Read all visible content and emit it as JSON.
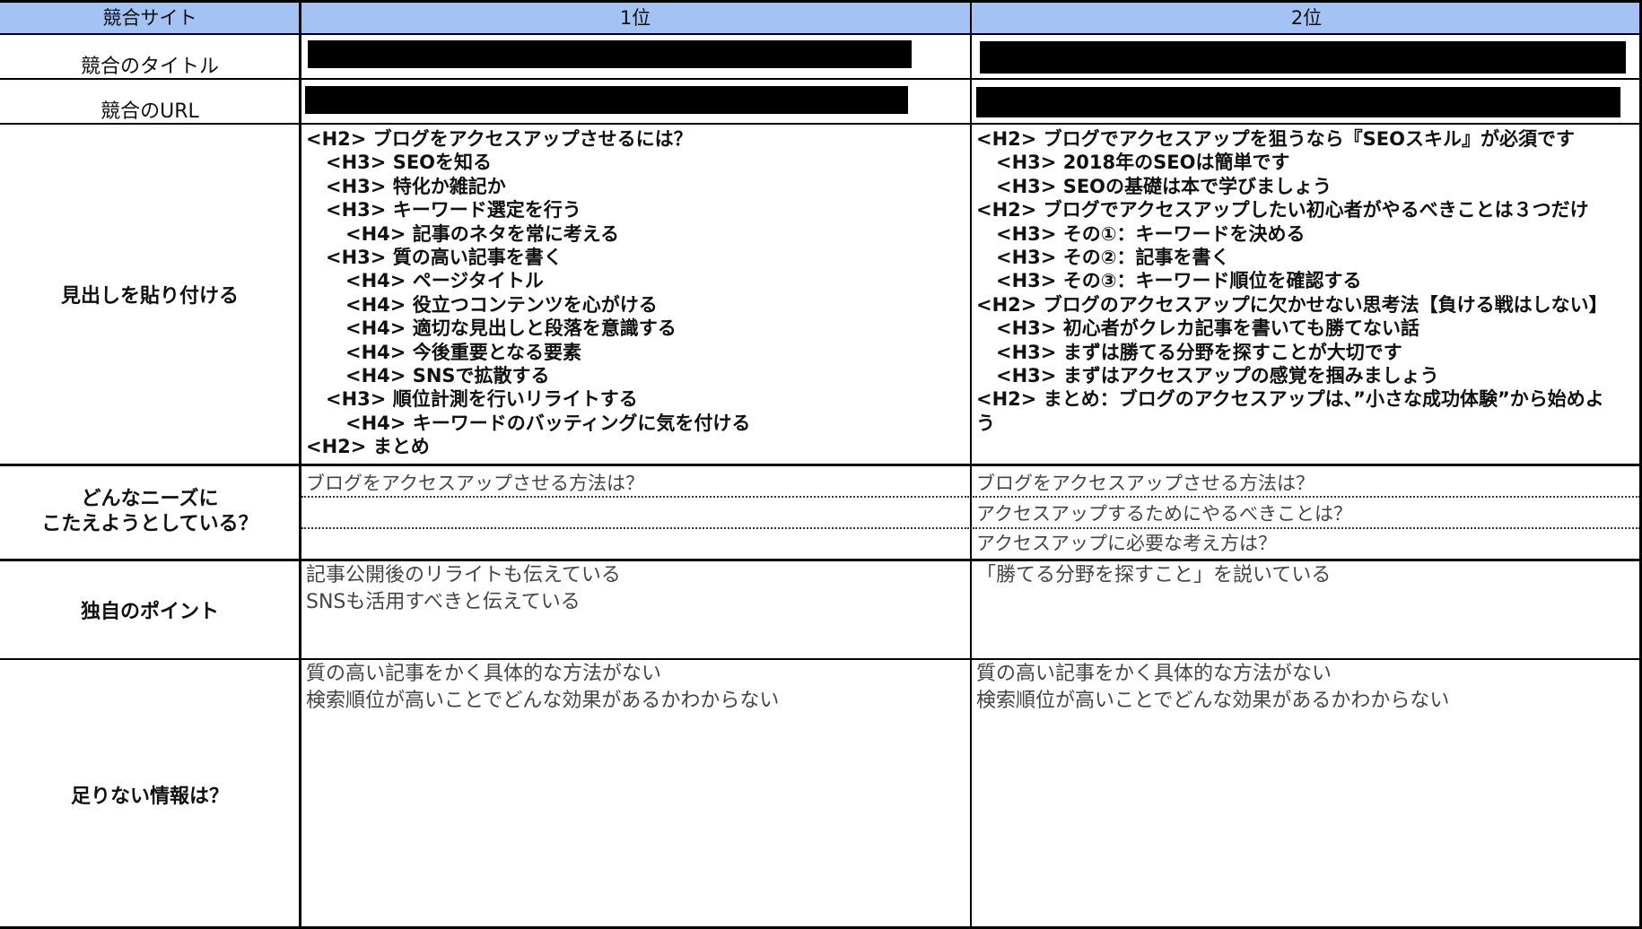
{
  "header": {
    "col_site": "競合サイト",
    "col_rank1": "1位",
    "col_rank2": "2位"
  },
  "rows": {
    "title_label": "競合のタイトル",
    "url_label": "競合のURL",
    "headings_label": "見出しを貼り付ける",
    "needs_label_line1": "どんなニーズに",
    "needs_label_line2": "こたえようとしている？",
    "unique_label": "独自のポイント",
    "missing_label": "足りない情報は？"
  },
  "rank1": {
    "headings": [
      {
        "level": 2,
        "text": "<H2> ブログをアクセスアップさせるには？"
      },
      {
        "level": 3,
        "text": "<H3> SEOを知る"
      },
      {
        "level": 3,
        "text": "<H3> 特化か雑記か"
      },
      {
        "level": 3,
        "text": "<H3> キーワード選定を行う"
      },
      {
        "level": 4,
        "text": "<H4> 記事のネタを常に考える"
      },
      {
        "level": 3,
        "text": "<H3> 質の高い記事を書く"
      },
      {
        "level": 4,
        "text": "<H4> ページタイトル"
      },
      {
        "level": 4,
        "text": "<H4> 役立つコンテンツを心がける"
      },
      {
        "level": 4,
        "text": "<H4> 適切な見出しと段落を意識する"
      },
      {
        "level": 4,
        "text": "<H4> 今後重要となる要素"
      },
      {
        "level": 4,
        "text": "<H4> SNSで拡散する"
      },
      {
        "level": 3,
        "text": "<H3> 順位計測を行いリライトする"
      },
      {
        "level": 4,
        "text": "<H4> キーワードのバッティングに気を付ける"
      },
      {
        "level": 2,
        "text": "<H2> まとめ"
      }
    ],
    "needs": [
      "ブログをアクセスアップさせる方法は？"
    ],
    "unique": [
      "記事公開後のリライトも伝えている",
      "SNSも活用すべきと伝えている"
    ],
    "missing": [
      "質の高い記事をかく具体的な方法がない",
      "検索順位が高いことでどんな効果があるかわからない"
    ]
  },
  "rank2": {
    "headings": [
      {
        "level": 2,
        "text": "<H2> ブログでアクセスアップを狙うなら『SEOスキル』が必須です"
      },
      {
        "level": 3,
        "text": "<H3> 2018年のSEOは簡単です"
      },
      {
        "level": 3,
        "text": "<H3> SEOの基礎は本で学びましょう"
      },
      {
        "level": 2,
        "text": "<H2> ブログでアクセスアップしたい初心者がやるべきことは３つだけ"
      },
      {
        "level": 3,
        "text": "<H3> その①：キーワードを決める"
      },
      {
        "level": 3,
        "text": "<H3> その②：記事を書く"
      },
      {
        "level": 3,
        "text": "<H3> その③：キーワード順位を確認する"
      },
      {
        "level": 2,
        "text": "<H2> ブログのアクセスアップに欠かせない思考法【負ける戦はしない】"
      },
      {
        "level": 3,
        "text": "<H3> 初心者がクレカ記事を書いても勝てない話"
      },
      {
        "level": 3,
        "text": "<H3> まずは勝てる分野を探すことが大切です"
      },
      {
        "level": 3,
        "text": "<H3> まずはアクセスアップの感覚を掴みましょう"
      },
      {
        "level": 2,
        "text": "<H2> まとめ：ブログのアクセスアップは、”小さな成功体験”から始めよう"
      }
    ],
    "needs": [
      "ブログをアクセスアップさせる方法は？",
      "アクセスアップするためにやるべきことは？",
      "アクセスアップに必要な考え方は？"
    ],
    "unique": [
      "「勝てる分野を探すこと」を説いている"
    ],
    "missing": [
      "質の高い記事をかく具体的な方法がない",
      "検索順位が高いことでどんな効果があるかわからない"
    ]
  }
}
